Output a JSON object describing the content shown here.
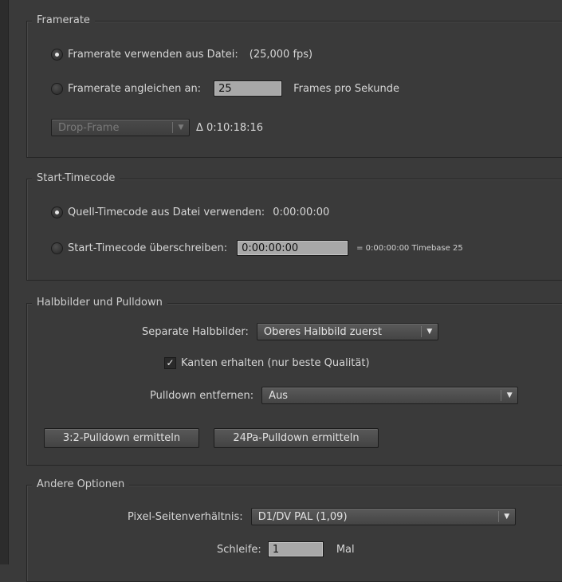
{
  "framerate": {
    "legend": "Framerate",
    "use_file_label": "Framerate verwenden aus Datei:",
    "use_file_value": "(25,000 fps)",
    "conform_label": "Framerate angleichen an:",
    "conform_value": "25",
    "conform_unit": "Frames pro Sekunde",
    "dropframe_value": "Drop-Frame",
    "delta": "Δ 0:10:18:16"
  },
  "timecode": {
    "legend": "Start-Timecode",
    "source_label": "Quell-Timecode aus Datei verwenden:",
    "source_value": "0:00:00:00",
    "override_label": "Start-Timecode überschreiben:",
    "override_value": "0:00:00:00",
    "result": "= 0:00:00:00  Timebase 25"
  },
  "fields": {
    "legend": "Halbbilder und Pulldown",
    "separate_label": "Separate Halbbilder:",
    "separate_value": "Oberes Halbbild zuerst",
    "preserve_label": "Kanten erhalten (nur beste Qualität)",
    "pulldown_label": "Pulldown entfernen:",
    "pulldown_value": "Aus",
    "btn_32": "3:2-Pulldown ermitteln",
    "btn_24pa": "24Pa-Pulldown ermitteln"
  },
  "other": {
    "legend": "Andere Optionen",
    "par_label": "Pixel-Seitenverhältnis:",
    "par_value": "D1/DV PAL (1,09)",
    "loop_label": "Schleife:",
    "loop_value": "1",
    "loop_unit": "Mal"
  },
  "icons": {
    "arrow": "▼",
    "check": "✓"
  }
}
